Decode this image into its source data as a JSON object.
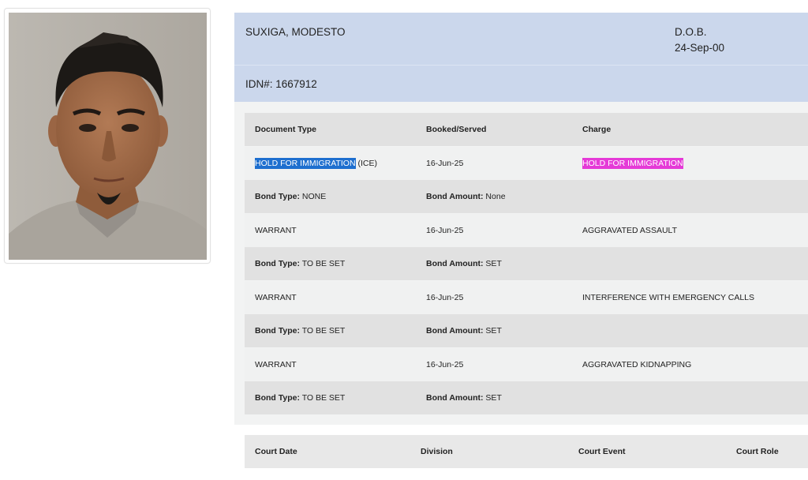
{
  "person": {
    "name": "SUXIGA, MODESTO",
    "dob_label": "D.O.B.",
    "dob_value": "24-Sep-00",
    "idn": "IDN#: 1667912"
  },
  "documents": {
    "headers": {
      "doc_type": "Document Type",
      "booked": "Booked/Served",
      "charge": "Charge"
    },
    "rows": [
      {
        "kind": "doc",
        "doc_type": "HOLD FOR IMMIGRATION",
        "doc_suffix": " (ICE)",
        "booked": "16-Jun-25",
        "charge": "HOLD FOR IMMIGRATION"
      },
      {
        "kind": "bond",
        "bond_type_label": "Bond Type:",
        "bond_type": " NONE",
        "bond_amount_label": "Bond Amount:",
        "bond_amount": " None"
      },
      {
        "kind": "doc",
        "doc_type": "WARRANT",
        "booked": "16-Jun-25",
        "charge": "AGGRAVATED ASSAULT"
      },
      {
        "kind": "bond",
        "bond_type_label": "Bond Type:",
        "bond_type": " TO BE SET",
        "bond_amount_label": "Bond Amount:",
        "bond_amount": " SET"
      },
      {
        "kind": "doc",
        "doc_type": "WARRANT",
        "booked": "16-Jun-25",
        "charge": "INTERFERENCE WITH EMERGENCY CALLS"
      },
      {
        "kind": "bond",
        "bond_type_label": "Bond Type:",
        "bond_type": " TO BE SET",
        "bond_amount_label": "Bond Amount:",
        "bond_amount": " SET"
      },
      {
        "kind": "doc",
        "doc_type": "WARRANT",
        "booked": "16-Jun-25",
        "charge": "AGGRAVATED KIDNAPPING"
      },
      {
        "kind": "bond",
        "bond_type_label": "Bond Type:",
        "bond_type": " TO BE SET",
        "bond_amount_label": "Bond Amount:",
        "bond_amount": " SET"
      }
    ]
  },
  "court": {
    "headers": {
      "date": "Court Date",
      "division": "Division",
      "event": "Court Event",
      "role": "Court Role"
    }
  },
  "colors": {
    "header_bg": "#cbd7ec",
    "selection_blue": "#1e6fcf",
    "highlight_pink": "#e53ad7"
  }
}
